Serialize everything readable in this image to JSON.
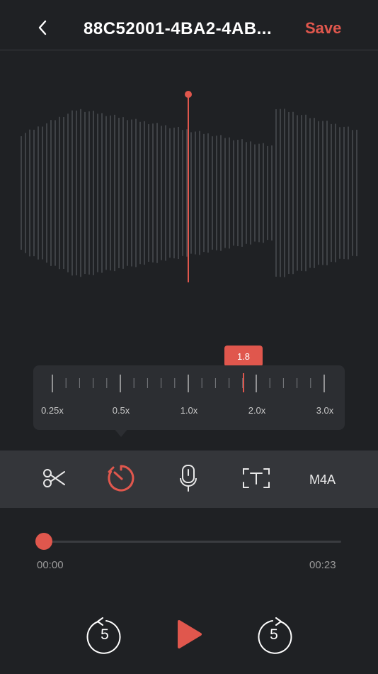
{
  "header": {
    "back_icon": "chevron-left-icon",
    "title": "88C52001-4BA2-4AB...",
    "save_label": "Save"
  },
  "colors": {
    "accent": "#e0574d",
    "background": "#1f2124",
    "toolbar": "#34363a",
    "panel": "#2c2e32"
  },
  "waveform": {
    "playhead_color": "#e0574d",
    "playhead_icon": "playhead-marker"
  },
  "speed": {
    "selected_value": "1.8",
    "labels": [
      "0.25x",
      "0.5x",
      "1.0x",
      "2.0x",
      "3.0x"
    ]
  },
  "toolbar": {
    "items": [
      {
        "name": "trim",
        "icon": "scissors-icon"
      },
      {
        "name": "speed",
        "icon": "speed-dial-icon",
        "active": true
      },
      {
        "name": "voice",
        "icon": "microphone-icon"
      },
      {
        "name": "transcribe",
        "icon": "text-frame-icon"
      },
      {
        "name": "format",
        "label": "M4A"
      }
    ]
  },
  "player": {
    "progress": 0.0,
    "current_time": "00:00",
    "total_time": "00:23",
    "rewind_label": "5",
    "forward_label": "5",
    "play_icon": "play-icon"
  }
}
